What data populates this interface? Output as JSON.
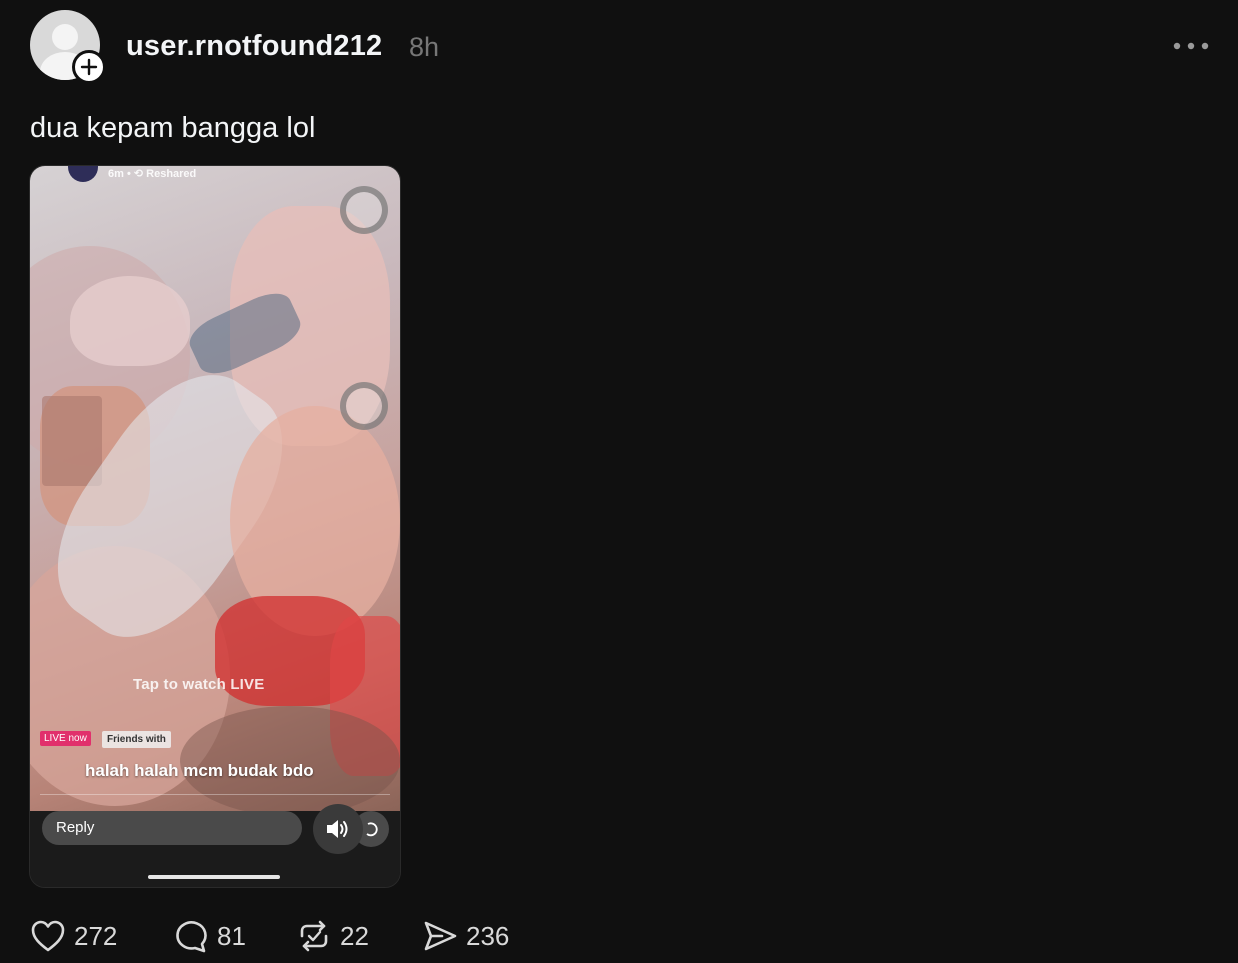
{
  "post": {
    "username": "user.rnotfound212",
    "timestamp": "8h",
    "caption": "dua kepam bangga lol"
  },
  "media": {
    "meta_top": "6m • ⟲ Reshared",
    "tap_to_watch": "Tap to watch LIVE",
    "live_badge": "LIVE now",
    "friends_badge": "Friends with",
    "overlay_text": "halah halah mcm budak bdo",
    "reply_placeholder": "Reply"
  },
  "actions": {
    "likes": "272",
    "comments": "81",
    "reposts": "22",
    "shares": "236"
  },
  "icons": {
    "avatar": "default-avatar-icon",
    "follow": "plus-icon",
    "more": "more-horizontal-icon",
    "like": "heart-icon",
    "comment": "comment-bubble-icon",
    "repost": "repost-icon",
    "share": "send-icon",
    "sound": "speaker-icon"
  },
  "colors": {
    "background": "#101010",
    "text": "#f3f5f7",
    "muted": "#777777",
    "live": "#e1306c"
  }
}
